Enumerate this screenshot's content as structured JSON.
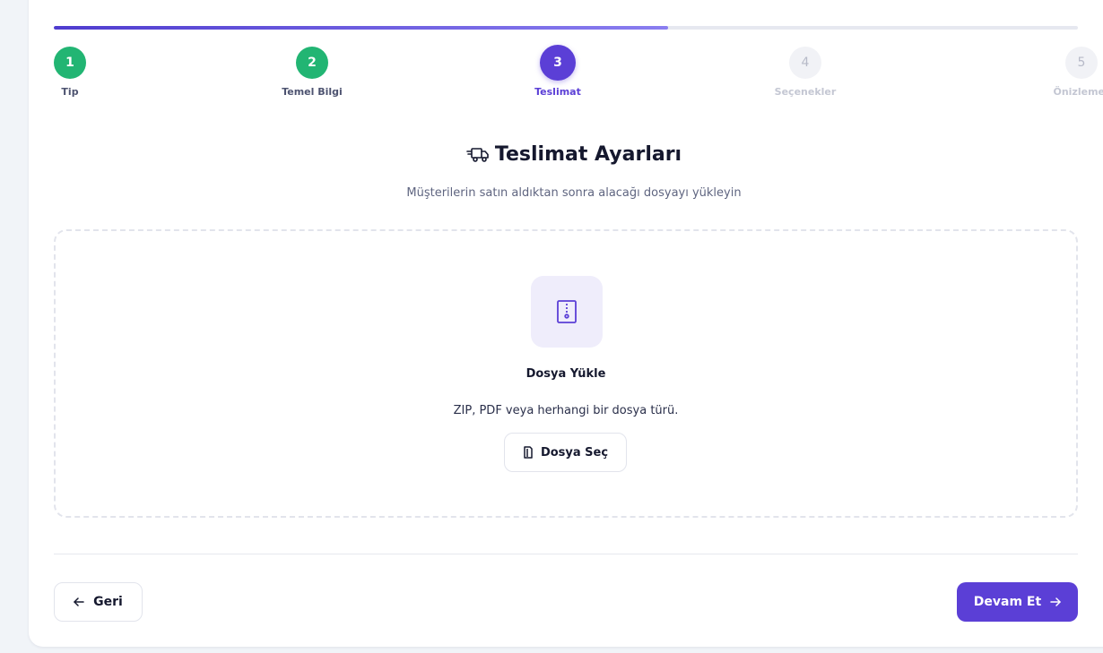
{
  "wizard": {
    "progress_percent": 60,
    "steps": [
      {
        "number": "1",
        "label": "Tip",
        "state": "done"
      },
      {
        "number": "2",
        "label": "Temel Bilgi",
        "state": "done"
      },
      {
        "number": "3",
        "label": "Teslimat",
        "state": "active"
      },
      {
        "number": "4",
        "label": "Seçenekler",
        "state": "todo"
      },
      {
        "number": "5",
        "label": "Önizleme",
        "state": "todo"
      }
    ]
  },
  "section": {
    "title": "Teslimat Ayarları",
    "title_icon": "truck-icon",
    "subtitle": "Müşterilerin satın aldıktan sonra alacağı dosyayı yükleyin"
  },
  "upload": {
    "icon": "file-archive-icon",
    "title": "Dosya Yükle",
    "hint": "ZIP, PDF veya herhangi bir dosya türü.",
    "button_label": "Dosya Seç",
    "button_icon": "file-icon"
  },
  "footer": {
    "back_label": "Geri",
    "next_label": "Devam Et"
  },
  "colors": {
    "accent": "#5b3fd6",
    "done": "#22b573",
    "todo": "#f1f2f6"
  }
}
